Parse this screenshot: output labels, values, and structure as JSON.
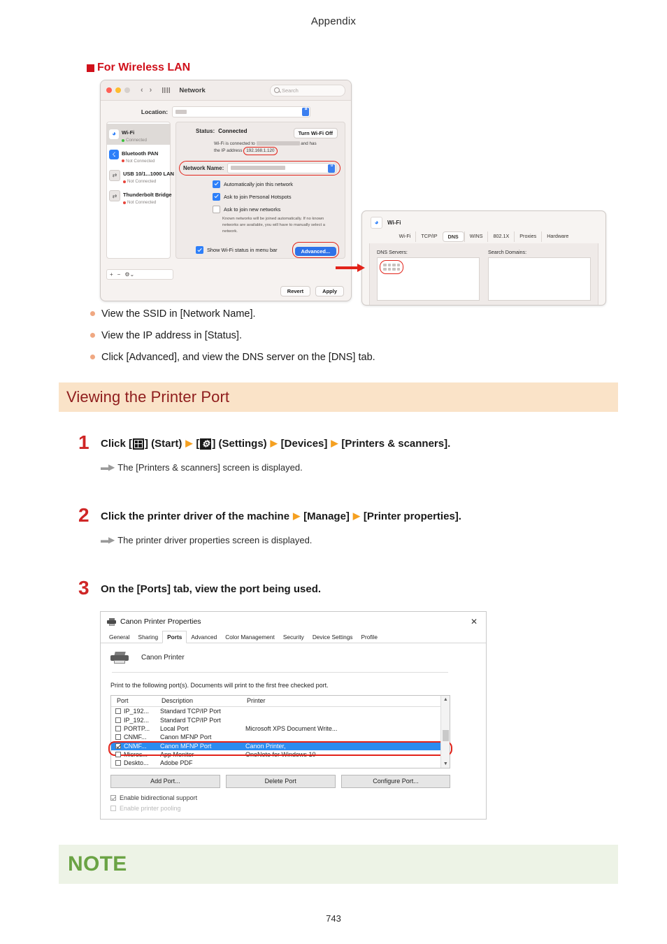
{
  "page": {
    "header_title": "Appendix",
    "page_number": "743"
  },
  "wireless_section": {
    "heading": "For Wireless LAN",
    "bullets": [
      "View the SSID in [Network Name].",
      "View the IP address in [Status].",
      "Click [Advanced], and view the DNS server on the [DNS] tab."
    ]
  },
  "mac_network_window": {
    "title": "Network",
    "search_placeholder": "Search",
    "location_label": "Location:",
    "sidebar": [
      {
        "name": "Wi-Fi",
        "status": "Connected",
        "connected": true,
        "icon": "wifi-icon"
      },
      {
        "name": "Bluetooth PAN",
        "status": "Not Connected",
        "connected": false,
        "icon": "bluetooth-icon"
      },
      {
        "name": "USB 10/1...1000 LAN",
        "status": "Not Connected",
        "connected": false,
        "icon": "ethernet-icon"
      },
      {
        "name": "Thunderbolt Bridge",
        "status": "Not Connected",
        "connected": false,
        "icon": "ethernet-icon"
      }
    ],
    "status_label": "Status:",
    "status_value": "Connected",
    "turn_off_button": "Turn Wi-Fi Off",
    "wifi_desc_part1": "Wi-Fi is connected to",
    "wifi_desc_part2": "and has",
    "wifi_desc_part3": "the IP address",
    "ip_address": "192.168.1.120",
    "network_name_label": "Network Name:",
    "checkboxes": [
      {
        "label": "Automatically join this network",
        "checked": true
      },
      {
        "label": "Ask to join Personal Hotspots",
        "checked": true
      },
      {
        "label": "Ask to join new networks",
        "checked": false
      }
    ],
    "helper_text": "Known networks will be joined automatically. If no known networks are available, you will have to manually select a network.",
    "show_status_label": "Show Wi-Fi status in menu bar",
    "advanced_button": "Advanced...",
    "revert_button": "Revert",
    "apply_button": "Apply"
  },
  "mac_dns_window": {
    "interface_label": "Wi-Fi",
    "tabs": [
      "Wi-Fi",
      "TCP/IP",
      "DNS",
      "WINS",
      "802.1X",
      "Proxies",
      "Hardware"
    ],
    "active_tab": "DNS",
    "dns_servers_label": "DNS Servers:",
    "search_domains_label": "Search Domains:"
  },
  "printer_port_section": {
    "heading": "Viewing the Printer Port",
    "steps": [
      {
        "number": "1",
        "title_parts": [
          "Click [",
          "] (Start)",
          "[",
          "] (Settings)",
          "[Devices]",
          "[Printers & scanners]."
        ],
        "result": "The [Printers & scanners] screen is displayed."
      },
      {
        "number": "2",
        "title_parts": [
          "Click the printer driver of the machine",
          "[Manage]",
          "[Printer properties]."
        ],
        "result": "The printer driver properties screen is displayed."
      },
      {
        "number": "3",
        "title_parts": [
          "On the [Ports] tab, view the port being used."
        ],
        "result": ""
      }
    ]
  },
  "step1": {
    "click": "Click [",
    "start": "] (Start)",
    "open_bracket": "[",
    "settings": "] (Settings)",
    "devices": "[Devices]",
    "printers": "[Printers & scanners].",
    "result": "The [Printers & scanners] screen is displayed."
  },
  "step2": {
    "main": "Click the printer driver of the machine",
    "manage": "[Manage]",
    "properties": "[Printer properties].",
    "result": "The printer driver properties screen is displayed."
  },
  "step3": {
    "number": "3",
    "main": "On the [Ports] tab, view the port being used."
  },
  "printer_properties_dialog": {
    "title": "Canon Printer Properties",
    "close_glyph": "✕",
    "tabs": [
      "General",
      "Sharing",
      "Ports",
      "Advanced",
      "Color Management",
      "Security",
      "Device Settings",
      "Profile"
    ],
    "active_tab": "Ports",
    "printer_name": "Canon Printer",
    "description": "Print to the following port(s). Documents will print to the first free checked port.",
    "table": {
      "columns": [
        "Port",
        "Description",
        "Printer"
      ],
      "rows": [
        {
          "checked": false,
          "port": "IP_192...",
          "description": "Standard TCP/IP Port",
          "printer": "",
          "selected": false
        },
        {
          "checked": false,
          "port": "IP_192...",
          "description": "Standard TCP/IP Port",
          "printer": "",
          "selected": false
        },
        {
          "checked": false,
          "port": "PORTP...",
          "description": "Local Port",
          "printer": "Microsoft XPS Document Write...",
          "selected": false
        },
        {
          "checked": false,
          "port": "CNMF...",
          "description": "Canon MFNP Port",
          "printer": "",
          "selected": false
        },
        {
          "checked": true,
          "port": "CNMF...",
          "description": "Canon MFNP Port",
          "printer": "Canon Printer,",
          "selected": true
        },
        {
          "checked": false,
          "port": "Micros...",
          "description": "App Monitor",
          "printer": "OneNote for Windows 10",
          "selected": false
        },
        {
          "checked": false,
          "port": "Deskto...",
          "description": "Adobe PDF",
          "printer": "",
          "selected": false
        }
      ]
    },
    "buttons": [
      "Add Port...",
      "Delete Port",
      "Configure Port..."
    ],
    "option_bidirectional": "Enable bidirectional support",
    "option_pooling": "Enable printer pooling"
  },
  "note": {
    "label": "NOTE"
  },
  "colors": {
    "accent_red": "#d0111b",
    "step_number_red": "#cf2626",
    "heading_band": "#fae3c8",
    "heading_text": "#8f1d1d",
    "note_band": "#edf3e6",
    "note_text": "#6aa344",
    "bullet_dot": "#f0a882",
    "arrow_orange": "#f5a020",
    "highlight_red": "#e2231a",
    "selection_blue": "#2b8cf0"
  }
}
